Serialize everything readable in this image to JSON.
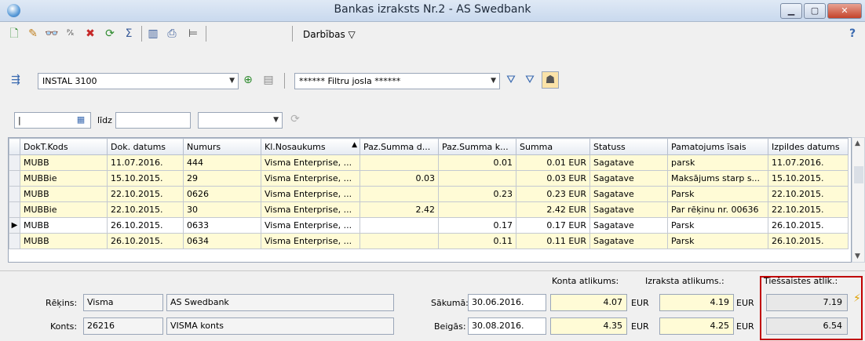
{
  "window": {
    "title": "Bankas izraksts Nr.2 - AS Swedbank"
  },
  "toolbar": {
    "menu_label": "Darbības ▽",
    "help_label": "?"
  },
  "selector": {
    "account": "INSTAL 3100",
    "filter": "****** Filtru josla ******"
  },
  "filter": {
    "to_label": "līdz"
  },
  "grid": {
    "headers": [
      "DokT.Kods",
      "Dok. datums",
      "Numurs",
      "Kl.Nosaukums",
      "Paz.Summa d...",
      "Paz.Summa k...",
      "Summa",
      "Statuss",
      "Pamatojums īsais",
      "Izpildes datums"
    ],
    "sort_marker": "▲",
    "rows": [
      [
        "MUBB",
        "11.07.2016.",
        "444",
        "Visma Enterprise, ...",
        "",
        "0.01",
        "0.01 EUR",
        "Sagatave",
        "parsk",
        "11.07.2016."
      ],
      [
        "MUBBie",
        "15.10.2015.",
        "29",
        "Visma Enterprise, ...",
        "0.03",
        "",
        "0.03 EUR",
        "Sagatave",
        "Maksājums starp s...",
        "15.10.2015."
      ],
      [
        "MUBB",
        "22.10.2015.",
        "0626",
        "Visma Enterprise, ...",
        "",
        "0.23",
        "0.23 EUR",
        "Sagatave",
        "Parsk",
        "22.10.2015."
      ],
      [
        "MUBBie",
        "22.10.2015.",
        "30",
        "Visma Enterprise, ...",
        "2.42",
        "",
        "2.42 EUR",
        "Sagatave",
        "Par rēķinu nr. 00636",
        "22.10.2015."
      ],
      [
        "MUBB",
        "26.10.2015.",
        "0633",
        "Visma Enterprise, ...",
        "",
        "0.17",
        "0.17 EUR",
        "Sagatave",
        "Parsk",
        "26.10.2015."
      ],
      [
        "MUBB",
        "26.10.2015.",
        "0634",
        "Visma Enterprise, ...",
        "",
        "0.11",
        "0.11 EUR",
        "Sagatave",
        "Parsk",
        "26.10.2015."
      ]
    ]
  },
  "footer": {
    "rekins_label": "Rēķins:",
    "rekins_code": "Visma",
    "rekins_name": "AS Swedbank",
    "konts_label": "Konts:",
    "konts_code": "26216",
    "konts_name": "VISMA konts",
    "konta_atlikums_label": "Konta atlikums:",
    "izraksta_atlikums_label": "Izraksta atlikums.:",
    "tiessaistes_label": "Tiešsaistes atlik.:",
    "sakuma_label": "Sākumā:",
    "sakuma_date": "30.06.2016.",
    "beigas_label": "Beigās:",
    "beigas_date": "30.08.2016.",
    "konta_start": "4.07",
    "konta_end": "4.35",
    "izraksta_start": "4.19",
    "izraksta_end": "4.25",
    "tiessaistes_start": "7.19",
    "tiessaistes_end": "6.54",
    "currency": "EUR"
  }
}
